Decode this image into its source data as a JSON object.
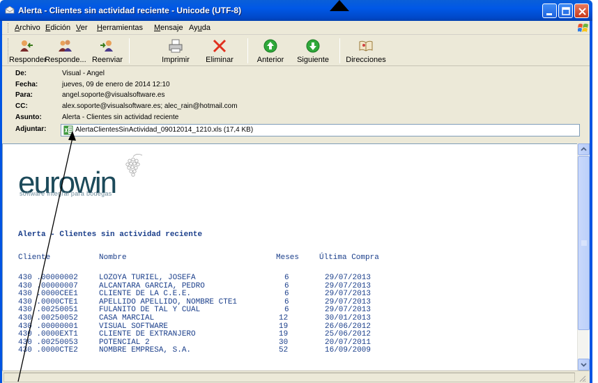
{
  "window": {
    "title": "Alerta - Clientes sin actividad reciente - Unicode (UTF-8)"
  },
  "menu": {
    "items": [
      "Archivo",
      "Edición",
      "Ver",
      "Herramientas",
      "Mensaje",
      "Ayuda"
    ]
  },
  "toolbar": {
    "buttons": [
      {
        "label": "Responder",
        "icon": "reply-icon"
      },
      {
        "label": "Responde...",
        "icon": "reply-all-icon"
      },
      {
        "label": "Reenviar",
        "icon": "forward-icon"
      },
      {
        "label": "Imprimir",
        "icon": "print-icon"
      },
      {
        "label": "Eliminar",
        "icon": "delete-icon"
      },
      {
        "label": "Anterior",
        "icon": "previous-icon"
      },
      {
        "label": "Siguiente",
        "icon": "next-icon"
      },
      {
        "label": "Direcciones",
        "icon": "address-book-icon"
      }
    ]
  },
  "header": {
    "from_label": "De:",
    "from_value": "Visual - Angel",
    "date_label": "Fecha:",
    "date_value": "jueves, 09 de enero de 2014 12:10",
    "to_label": "Para:",
    "to_value": "angel.soporte@visualsoftware.es",
    "cc_label": "CC:",
    "cc_value": "alex.soporte@visualsoftware.es; alec_rain@hotmail.com",
    "subject_label": "Asunto:",
    "subject_value": "Alerta - Clientes sin actividad reciente",
    "attach_label": "Adjuntar:",
    "attach_value": "AlertaClientesSinActividad_09012014_1210.xls (17,4 KB)"
  },
  "body": {
    "logo_text": "eurowin",
    "logo_subtitle": "software integral para bodegas",
    "alert_title": "Alerta - Clientes sin actividad reciente",
    "columns": [
      "Cliente",
      "Nombre",
      "Meses",
      "Última Compra"
    ],
    "rows": [
      [
        "430 .00000002",
        "LOZOYA TURIEL, JOSEFA",
        "6",
        "29/07/2013"
      ],
      [
        "430 .00000007",
        "ALCANTARA GARCIA, PEDRO",
        "6",
        "29/07/2013"
      ],
      [
        "430 .0000CEE1",
        "CLIENTE DE LA C.E.E.",
        "6",
        "29/07/2013"
      ],
      [
        "430 .0000CTE1",
        "APELLIDO APELLIDO, NOMBRE CTE1",
        "6",
        "29/07/2013"
      ],
      [
        "430 .00250051",
        "FULANITO DE TAL Y CUAL",
        "6",
        "29/07/2013"
      ],
      [
        "430 .00250052",
        "CASA MARCIAL",
        "12",
        "30/01/2013"
      ],
      [
        "430 .00000001",
        "VISUAL SOFTWARE",
        "19",
        "26/06/2012"
      ],
      [
        "430 .0000EXT1",
        "CLIENTE DE EXTRANJERO",
        "19",
        "25/06/2012"
      ],
      [
        "430 .00250053",
        "POTENCIAL 2",
        "30",
        "20/07/2011"
      ],
      [
        "430 .0000CTE2",
        "NOMBRE EMPRESA, S.A.",
        "52",
        "16/09/2009"
      ]
    ]
  },
  "colors": {
    "titlebar": "#0058e6",
    "chrome": "#ece9d8",
    "body_text": "#1b3f8b"
  }
}
